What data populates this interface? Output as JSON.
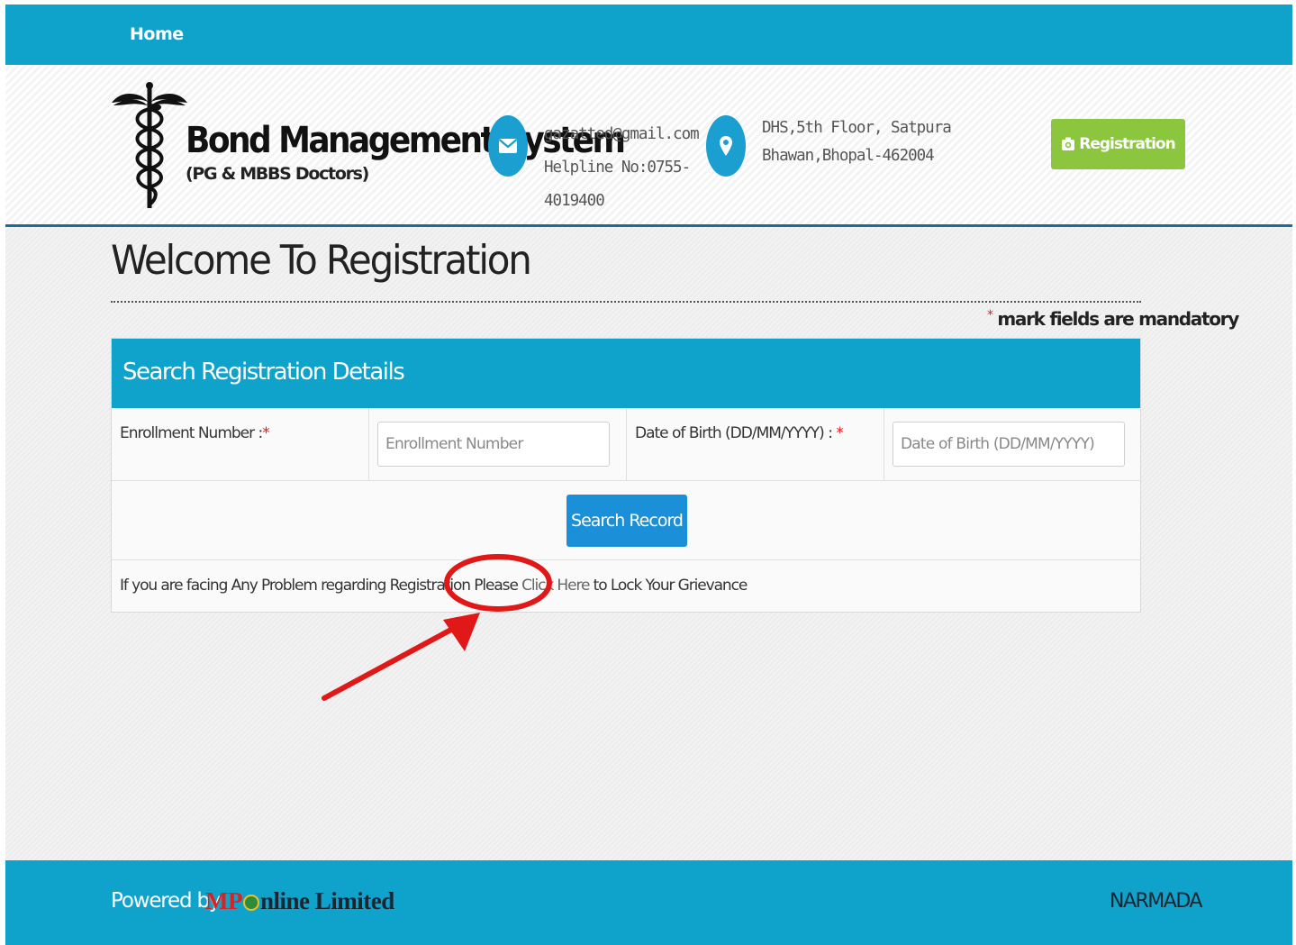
{
  "nav": {
    "home_label": "Home"
  },
  "header": {
    "title": "Bond Management System",
    "subtitle": "(PG & MBBS Doctors)",
    "contact": {
      "email": "gazatted@gmail.com",
      "helpline_line1": "Helpline No:0755-",
      "helpline_line2": "4019400",
      "icon": "envelope-icon"
    },
    "address": {
      "line1": "DHS,5th Floor, Satpura",
      "line2": "Bhawan,Bhopal-462004",
      "icon": "map-pin-icon"
    },
    "registration_button": "Registration"
  },
  "main": {
    "page_title": "Welcome To Registration",
    "mandatory_star": "*",
    "mandatory_note": "mark fields are mandatory",
    "panel": {
      "title": "Search Registration Details",
      "enrollment_label": "Enrollment Number :",
      "enrollment_placeholder": "Enrollment Number",
      "enrollment_value": "",
      "dob_label": "Date of Birth (DD/MM/YYYY) : ",
      "dob_placeholder": "Date of Birth (DD/MM/YYYY)",
      "dob_value": "",
      "required_mark": "*",
      "search_button": "Search Record",
      "grievance_prefix": "If you are facing Any Problem regarding Registration Please ",
      "grievance_link": "Click Here",
      "grievance_suffix": " to Lock Your Grievance"
    }
  },
  "footer": {
    "powered_by": "Powered by",
    "brand_mp": "MP",
    "brand_rest": "nline Limited",
    "server_name": "NARMADA"
  },
  "colors": {
    "primary_blue": "#0fa3cc",
    "button_green": "#8cc63f",
    "button_blue": "#1b8fd8",
    "annotation_red": "#e01818"
  }
}
